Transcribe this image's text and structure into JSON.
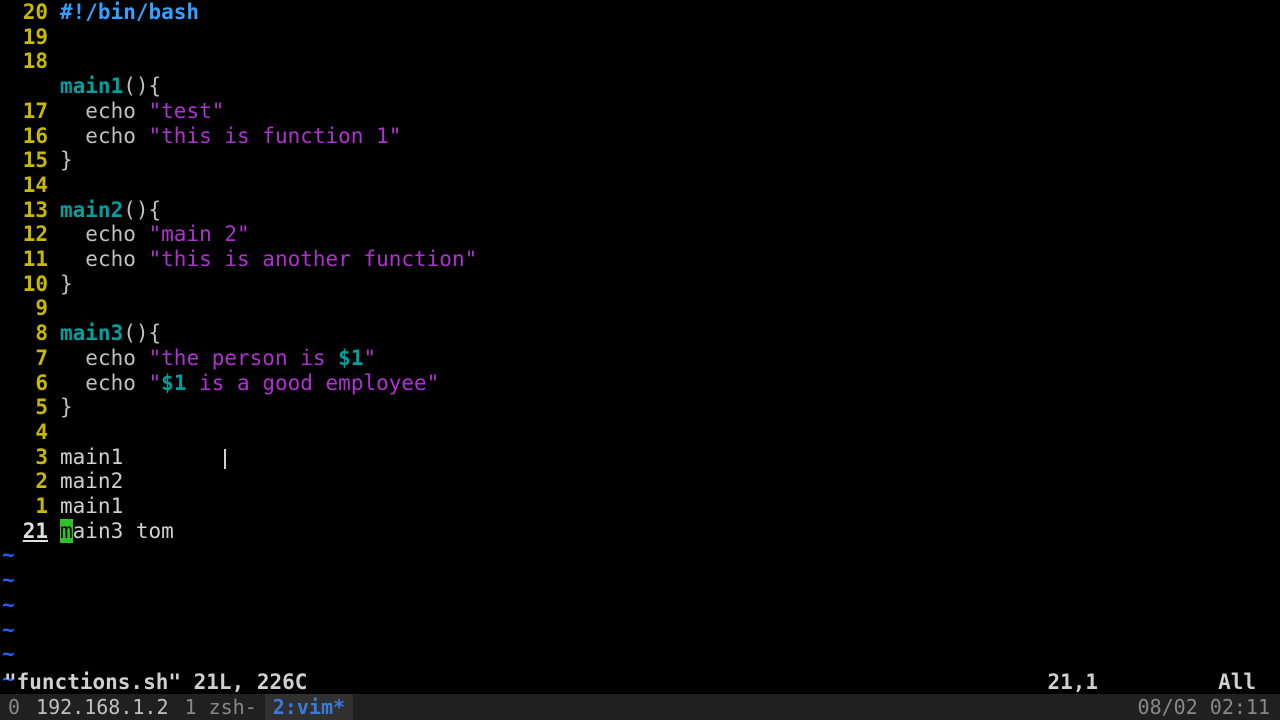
{
  "gutter": {
    "rel": [
      "20",
      "19",
      "18",
      "17",
      "16",
      "15",
      "14",
      "13",
      "12",
      "11",
      "10",
      "9",
      "8",
      "7",
      "6",
      "5",
      "4",
      "3",
      "2",
      "1"
    ],
    "cur": "21"
  },
  "code": {
    "shebang": "#!/bin/bash",
    "fn1_name": "main1",
    "fn1_parens": "()",
    "fn1_brace_open": "{",
    "fn1_l1_kw": "echo",
    "fn1_l1_str": " \"test\"",
    "fn1_l2_kw": "echo",
    "fn1_l2_str": " \"this is function 1\"",
    "fn_brace_close": "}",
    "fn2_name": "main2",
    "fn2_parens": "()",
    "fn2_brace_open": "{",
    "fn2_l1_kw": "echo",
    "fn2_l1_str": " \"main 2\"",
    "fn2_l2_kw": "echo",
    "fn2_l2_str": " \"this is another function\"",
    "fn3_name": "main3",
    "fn3_parens": "()",
    "fn3_brace_open": "{",
    "fn3_l1_kw": "echo",
    "fn3_l1_s1": " \"the person is ",
    "fn3_l1_var": "$1",
    "fn3_l1_s2": "\"",
    "fn3_l2_kw": "echo",
    "fn3_l2_s1": " \"",
    "fn3_l2_var": "$1",
    "fn3_l2_s2": " is a good employee\"",
    "call1": "main1",
    "call2": "main2",
    "call3": "main1",
    "cur_cursor_char": "m",
    "cur_rest": "ain3 tom",
    "indent": "  "
  },
  "tilde": "~",
  "status": {
    "left": "\"functions.sh\" 21L, 226C",
    "ruler": "21,1",
    "pos": "All"
  },
  "tmux": {
    "session_idx": "0",
    "host": "192.168.1.2",
    "win1_idx": "1",
    "win1_name": "zsh-",
    "win2_idx": "2:",
    "win2_name": "vim*",
    "clock": "08/02 02:11"
  }
}
